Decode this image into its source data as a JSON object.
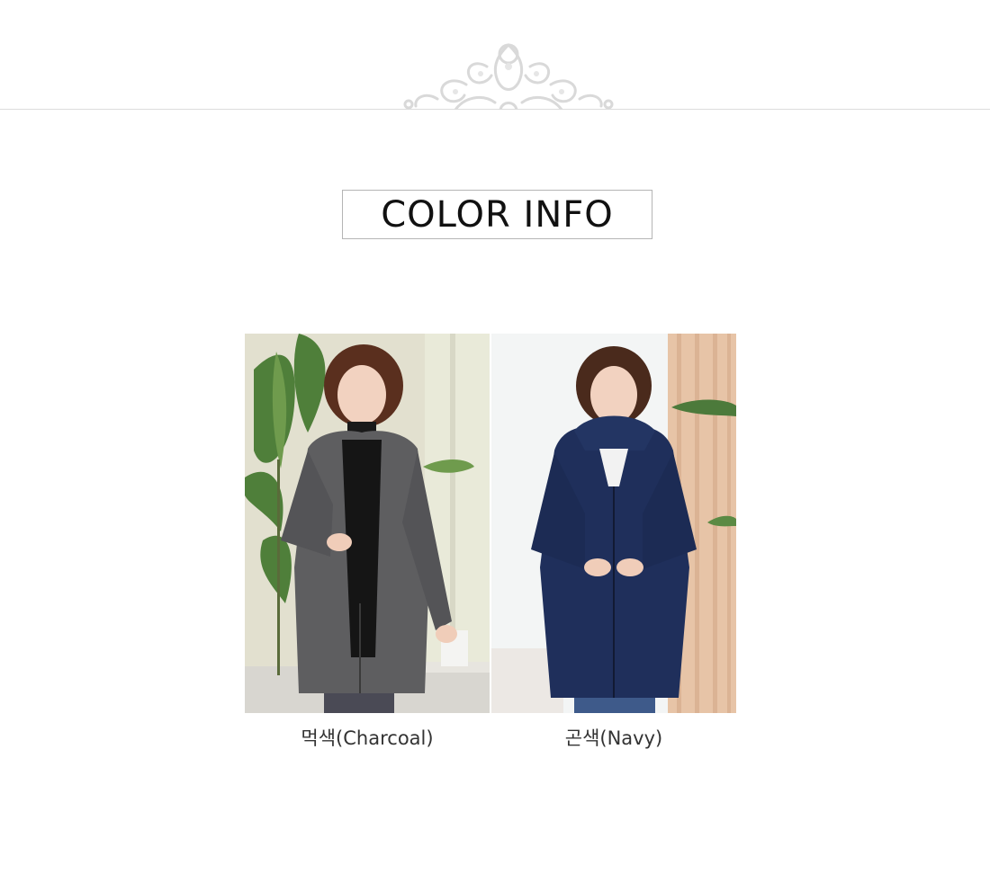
{
  "section": {
    "ornament_icon": "lace-ornament-icon",
    "title": "COLOR INFO"
  },
  "colors": [
    {
      "label": "먹색(Charcoal)",
      "swatch_color": "#5b5b5e",
      "photo": "model-charcoal-photo"
    },
    {
      "label": "곤색(Navy)",
      "swatch_color": "#1e2f5c",
      "photo": "model-navy-photo"
    }
  ]
}
